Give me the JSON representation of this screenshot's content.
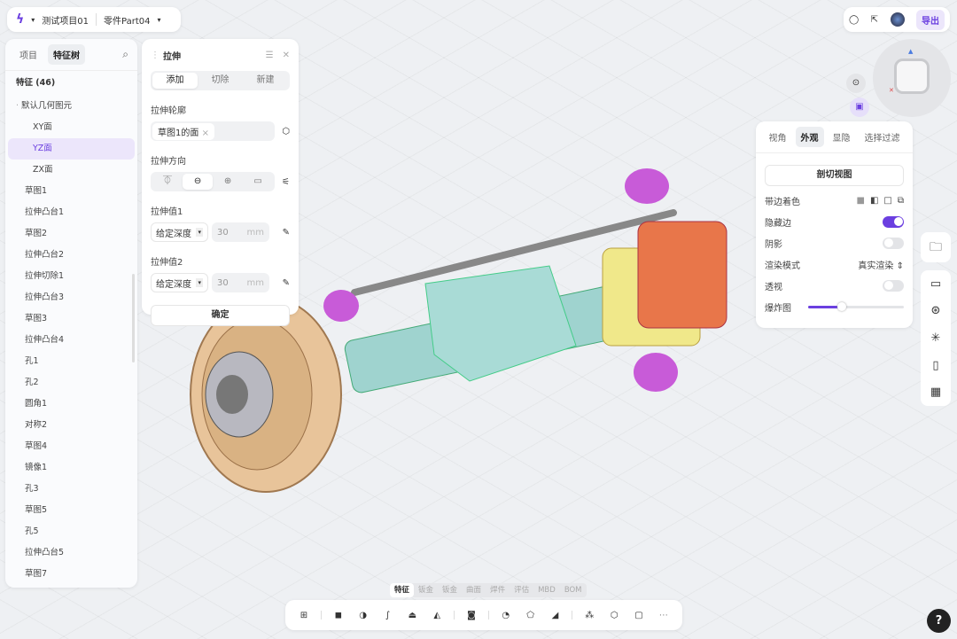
{
  "header": {
    "project": "测试项目01",
    "part": "零件Part04",
    "export_label": "导出"
  },
  "left_panel": {
    "tabs": [
      {
        "label": "项目",
        "active": false
      },
      {
        "label": "特征树",
        "active": true
      }
    ],
    "feature_count_label": "特征 (46)",
    "group": "默认几何图元",
    "items": [
      "XY面",
      "YZ面",
      "ZX面",
      "草图1",
      "拉伸凸台1",
      "草图2",
      "拉伸凸台2",
      "拉伸切除1",
      "拉伸凸台3",
      "草图3",
      "拉伸凸台4",
      "孔1",
      "孔2",
      "圆角1",
      "对称2",
      "草图4",
      "镜像1",
      "孔3",
      "草图5",
      "孔5",
      "拉伸凸台5",
      "草图7"
    ],
    "selected": "YZ面"
  },
  "extrude_panel": {
    "title": "拉伸",
    "modes": [
      "添加",
      "切除",
      "新建"
    ],
    "active_mode": "添加",
    "profile_label": "拉伸轮廓",
    "profile_value": "草图1的面",
    "direction_label": "拉伸方向",
    "value1_label": "拉伸值1",
    "value1_type": "给定深度",
    "value1": "30",
    "value1_unit": "mm",
    "value2_label": "拉伸值2",
    "value2_type": "给定深度",
    "value2": "30",
    "value2_unit": "mm",
    "confirm_label": "确定"
  },
  "appearance_panel": {
    "tabs": [
      "视角",
      "外观",
      "显隐",
      "选择过滤"
    ],
    "active_tab": "外观",
    "section_view_label": "剖切视图",
    "shaded_edges_label": "带边着色",
    "hidden_edges_label": "隐藏边",
    "hidden_edges_on": true,
    "shadow_label": "阴影",
    "shadow_on": false,
    "render_mode_label": "渲染模式",
    "render_mode_value": "真实渲染",
    "perspective_label": "透视",
    "perspective_on": false,
    "explode_label": "爆炸图",
    "explode_value": 0.35
  },
  "bottom_tabs": [
    "特征",
    "钣金",
    "钣金",
    "曲面",
    "焊件",
    "评估",
    "MBD",
    "BOM"
  ],
  "bottom_active": "特征",
  "colors": {
    "accent": "#6b3fe0",
    "selected_bg": "#ece6fb"
  },
  "help_label": "?"
}
